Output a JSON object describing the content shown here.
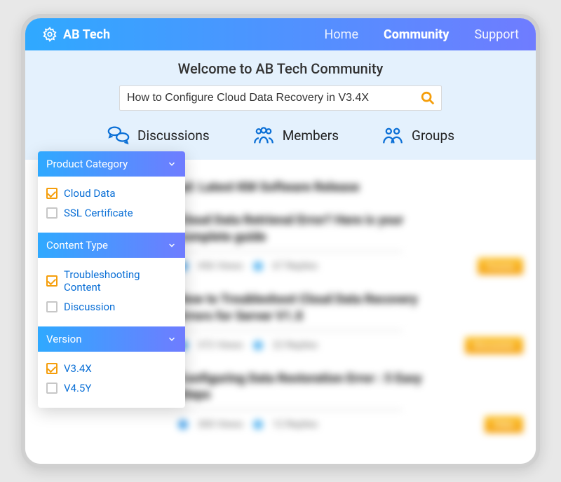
{
  "brand": {
    "name": "AB Tech"
  },
  "nav": {
    "items": [
      {
        "label": "Home",
        "active": false
      },
      {
        "label": "Community",
        "active": true
      },
      {
        "label": "Support",
        "active": false
      }
    ]
  },
  "hero": {
    "title": "Welcome to AB Tech Community",
    "search_value": "How to Configure Cloud Data Recovery in V3.4X"
  },
  "tabs": {
    "discussions": "Discussions",
    "members": "Members",
    "groups": "Groups"
  },
  "facets": [
    {
      "title": "Product Category",
      "options": [
        {
          "label": "Cloud Data",
          "checked": true
        },
        {
          "label": "SSL Certificate",
          "checked": false
        }
      ]
    },
    {
      "title": "Content Type",
      "options": [
        {
          "label": "Troubleshooting Content",
          "checked": true
        },
        {
          "label": "Discussion",
          "checked": false
        }
      ]
    },
    {
      "title": "Version",
      "options": [
        {
          "label": "V3.4X",
          "checked": true
        },
        {
          "label": "V4.5Y",
          "checked": false
        }
      ]
    }
  ],
  "pinned": {
    "title": "ad: Latest KM Software Release"
  },
  "posts": [
    {
      "title": "Cloud Data Retrieval Error? Here is your complete guide",
      "views": "456 Views",
      "replies": "67 Replies",
      "tag": "Forums"
    },
    {
      "title": "How to Troubleshoot Cloud Data Recovery Errors for Server V1.X",
      "views": "372 Views",
      "replies": "22 Replies",
      "tag": "Discussion"
    },
    {
      "title": "Configuring Data Restoration Error : 5 Easy Steps",
      "views": "300 Views",
      "replies": "12 Replies",
      "tag": "Video"
    }
  ]
}
